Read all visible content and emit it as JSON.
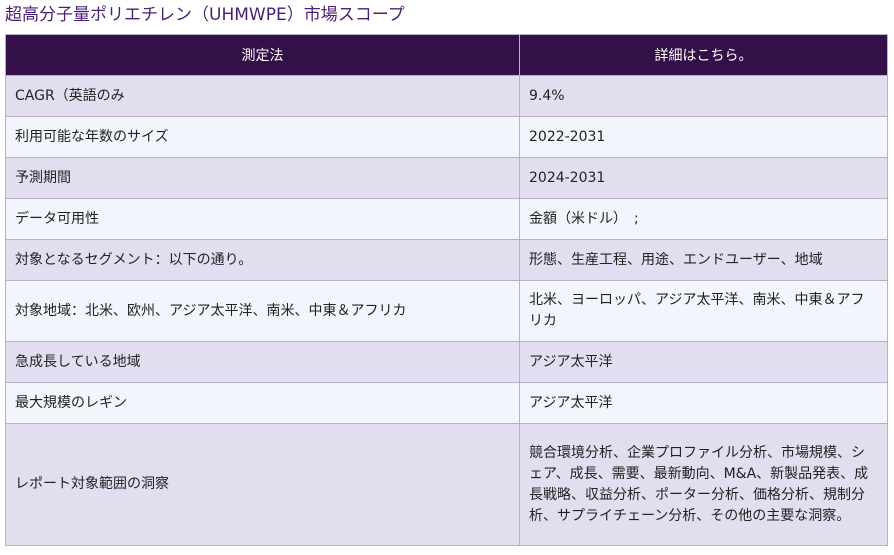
{
  "title": "超高分子量ポリエチレン（UHMWPE）市場スコープ",
  "table": {
    "headers": [
      "測定法",
      "詳細はこちら。"
    ],
    "rows": [
      [
        "CAGR（英語のみ",
        "9.4%"
      ],
      [
        "利用可能な年数のサイズ",
        "2022-2031"
      ],
      [
        "予測期間",
        "2024-2031"
      ],
      [
        "データ可用性",
        "金額（米ドル）　;"
      ],
      [
        "対象となるセグメント：以下の通り。",
        "形態、生産工程、用途、エンドユーザー、地域"
      ],
      [
        "対象地域：北米、欧州、アジア太平洋、南米、中東＆アフリカ",
        "北米、ヨーロッパ、アジア太平洋、南米、中東＆アフリカ"
      ],
      [
        "急成長している地域",
        "アジア太平洋"
      ],
      [
        "最大規模のレギン",
        "アジア太平洋"
      ],
      [
        "レポート対象範囲の洞察",
        "競合環境分析、企業プロファイル分析、市場規模、シェア、成長、需要、最新動向、M&A、新製品発表、成長戦略、収益分析、ポーター分析、価格分析、規制分析、サプライチェーン分析、その他の主要な洞察。"
      ]
    ]
  }
}
